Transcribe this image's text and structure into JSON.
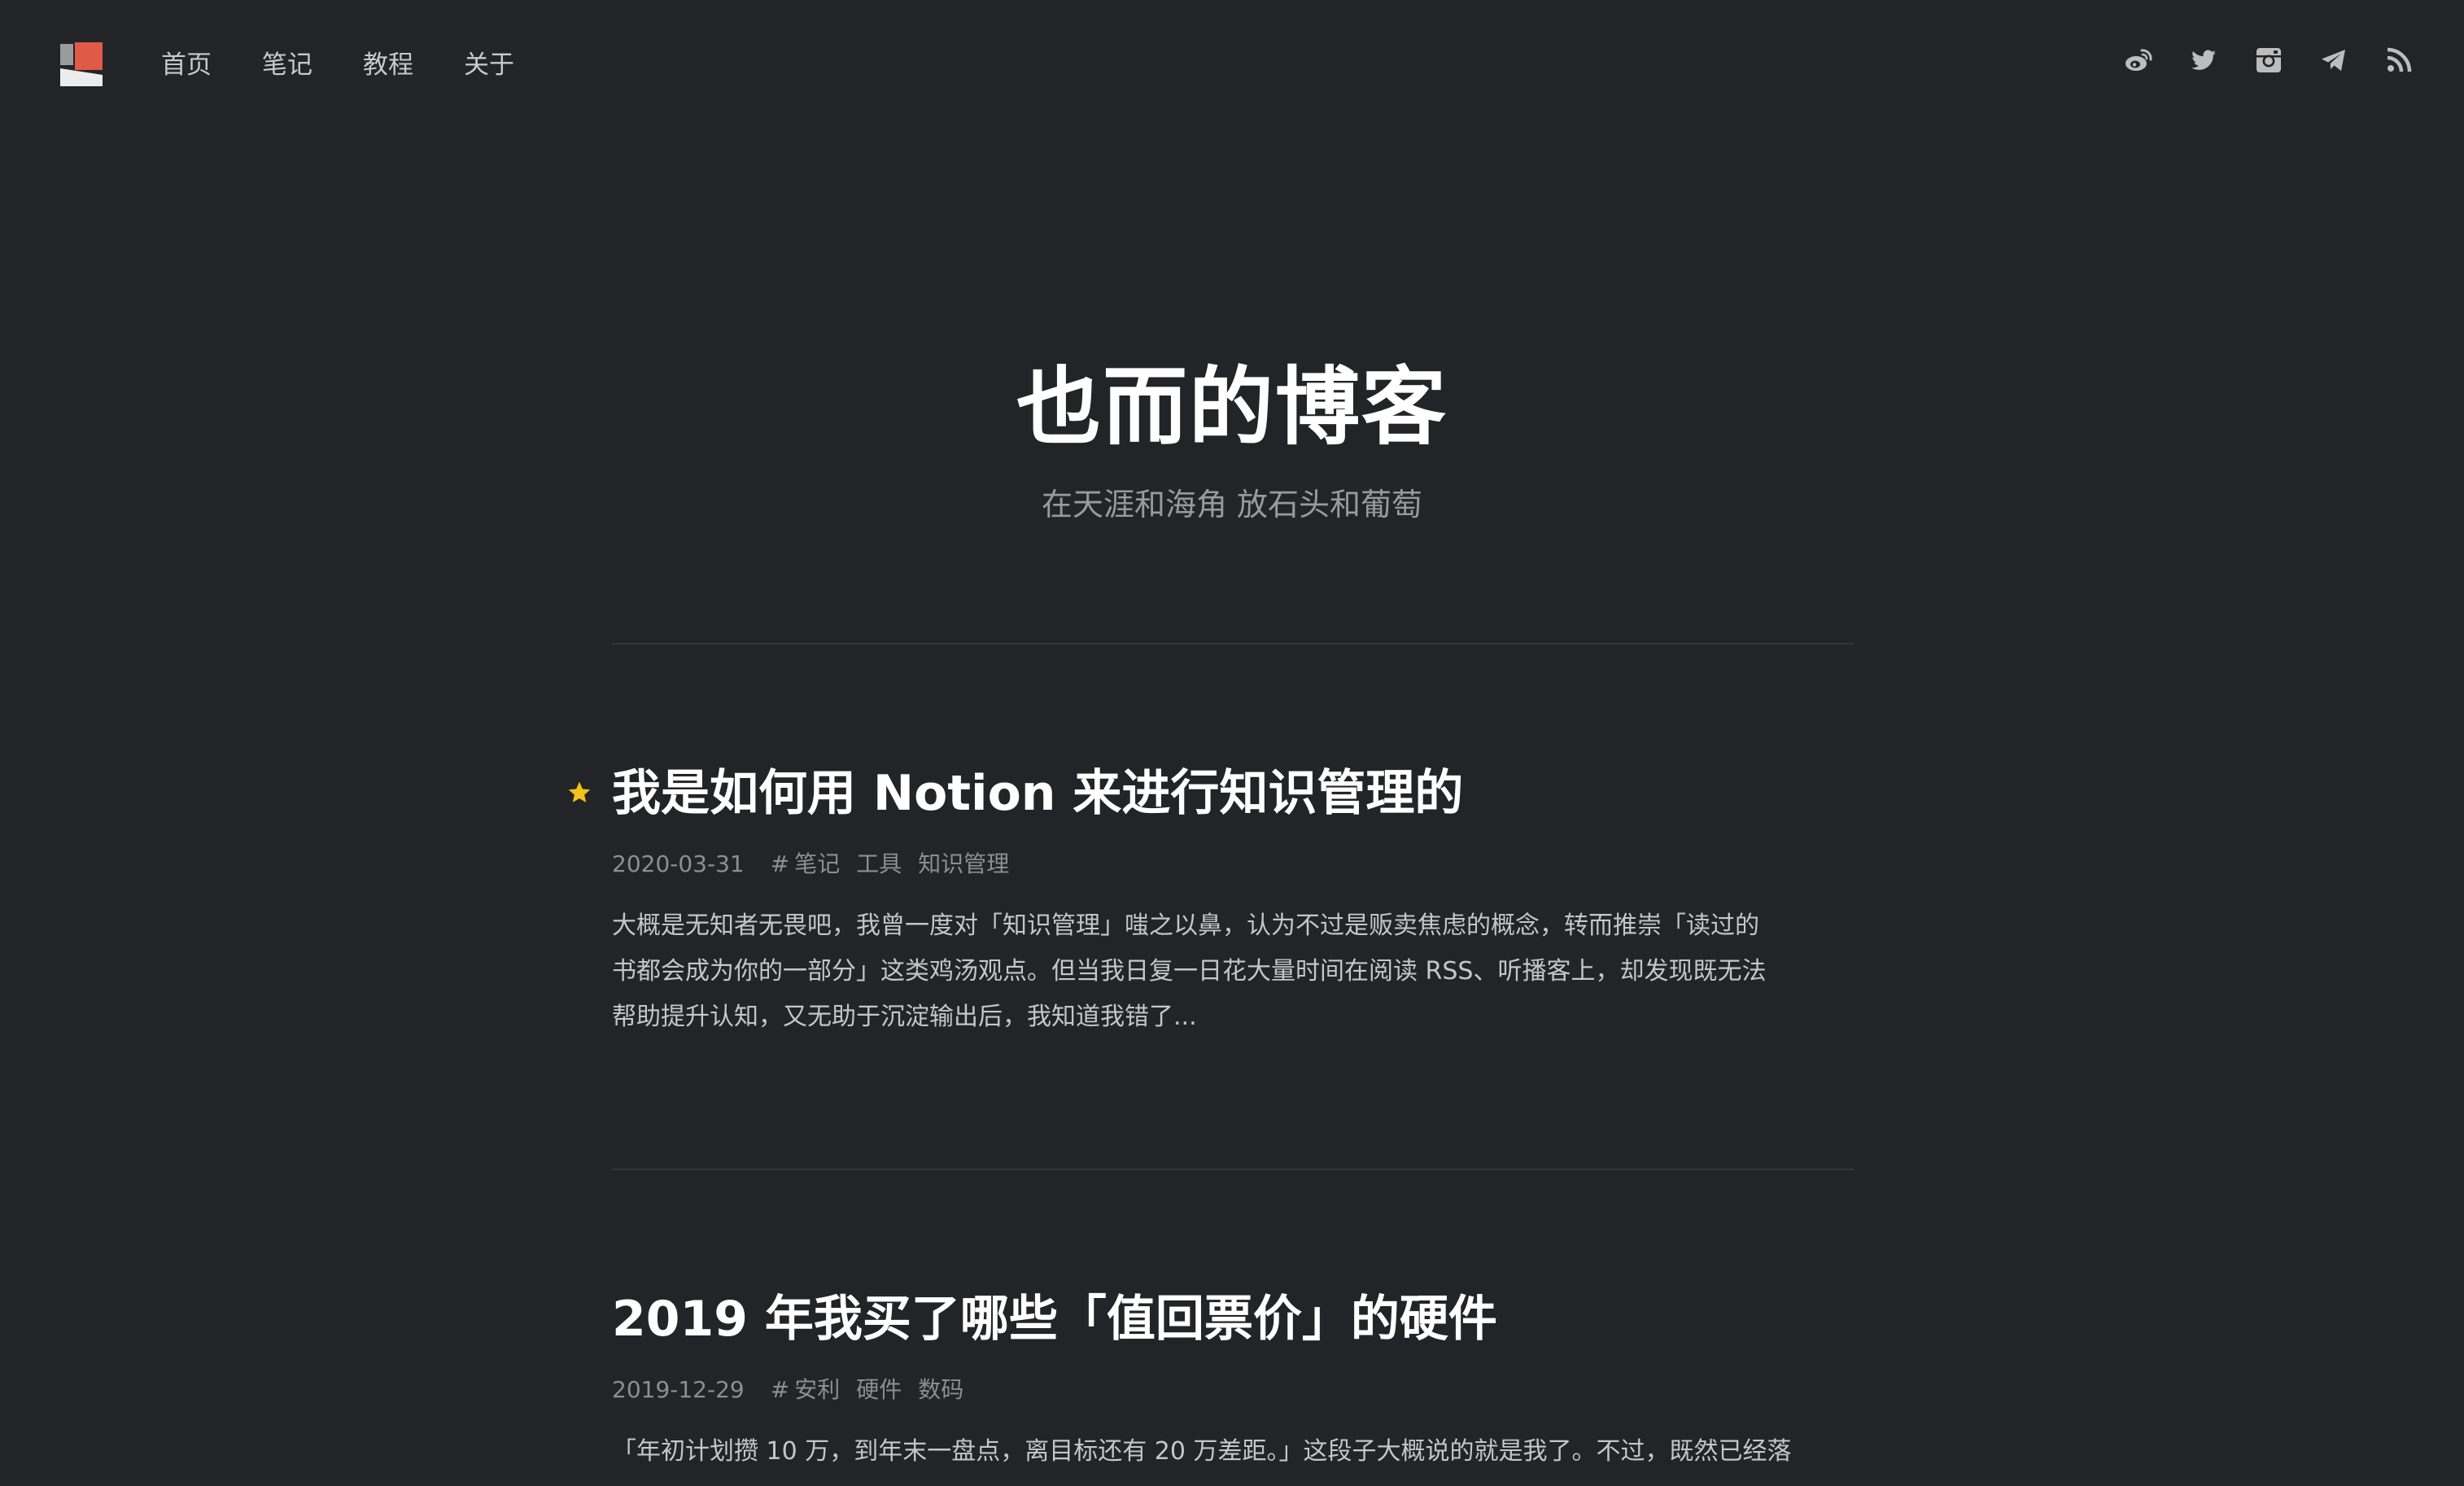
{
  "nav": {
    "items": [
      {
        "label": "首页"
      },
      {
        "label": "笔记"
      },
      {
        "label": "教程"
      },
      {
        "label": "关于"
      }
    ]
  },
  "social": [
    "weibo-icon",
    "twitter-icon",
    "instagram-icon",
    "telegram-icon",
    "rss-icon"
  ],
  "hero": {
    "title": "也而的博客",
    "subtitle": "在天涯和海角 放石头和葡萄"
  },
  "posts": [
    {
      "title": "我是如何用 Notion 来进行知识管理的",
      "featured": true,
      "date": "2020-03-31",
      "hash": "#",
      "tags": [
        "笔记",
        "工具",
        "知识管理"
      ],
      "excerpt_lines": [
        "大概是无知者无畏吧，我曾一度对「知识管理」嗤之以鼻，认为不过是贩卖焦虑的概念，转而推崇「读过的",
        "书都会成为你的一部分」这类鸡汤观点。但当我日复一日花大量时间在阅读 RSS、听播客上，却发现既无法",
        "帮助提升认知，又无助于沉淀输出后，我知道我错了..."
      ]
    },
    {
      "title": "2019 年我买了哪些「值回票价」的硬件",
      "featured": false,
      "date": "2019-12-29",
      "hash": "#",
      "tags": [
        "安利",
        "硬件",
        "数码"
      ],
      "excerpt_lines": [
        "「年初计划攒 10 万，到年末一盘点，离目标还有 20 万差距。」这段子大概说的就是我了。不过，既然已经落"
      ]
    }
  ],
  "colors": {
    "background": "#232427",
    "logo_red": "#e05a47",
    "star": "#f2c21b"
  }
}
